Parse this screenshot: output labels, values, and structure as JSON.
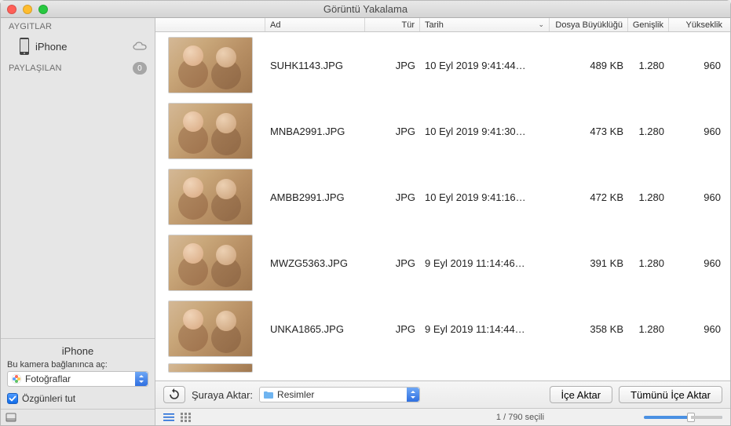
{
  "window": {
    "title": "Görüntü Yakalama"
  },
  "sidebar": {
    "sections": [
      {
        "label": "AYGITLAR",
        "badge": null
      },
      {
        "label": "PAYLAŞILAN",
        "badge": "0"
      }
    ],
    "devices": [
      {
        "name": "iPhone",
        "hasCloud": true
      }
    ],
    "connected_device": "iPhone",
    "connect_label": "Bu kamera bağlanınca aç:",
    "open_with": "Fotoğraflar",
    "keep_originals_label": "Özgünleri tut",
    "keep_originals_checked": true
  },
  "columns": {
    "thumb": "",
    "name": "Ad",
    "type": "Tür",
    "date": "Tarih",
    "size": "Dosya Büyüklüğü",
    "width": "Genişlik",
    "height": "Yükseklik"
  },
  "rows": [
    {
      "name": "SUHK1143.JPG",
      "type": "JPG",
      "date": "10 Eyl 2019 9:41:44…",
      "size": "489 KB",
      "w": "1.280",
      "h": "960"
    },
    {
      "name": "MNBA2991.JPG",
      "type": "JPG",
      "date": "10 Eyl 2019 9:41:30…",
      "size": "473 KB",
      "w": "1.280",
      "h": "960"
    },
    {
      "name": "AMBB2991.JPG",
      "type": "JPG",
      "date": "10 Eyl 2019 9:41:16…",
      "size": "472 KB",
      "w": "1.280",
      "h": "960"
    },
    {
      "name": "MWZG5363.JPG",
      "type": "JPG",
      "date": "9 Eyl 2019 11:14:46…",
      "size": "391 KB",
      "w": "1.280",
      "h": "960"
    },
    {
      "name": "UNKA1865.JPG",
      "type": "JPG",
      "date": "9 Eyl 2019 11:14:44…",
      "size": "358 KB",
      "w": "1.280",
      "h": "960"
    }
  ],
  "toolbar": {
    "transfer_label": "Şuraya Aktar:",
    "destination": "Resimler",
    "import": "İçe Aktar",
    "import_all": "Tümünü İçe Aktar"
  },
  "status": {
    "text": "1 / 790 seçili"
  }
}
